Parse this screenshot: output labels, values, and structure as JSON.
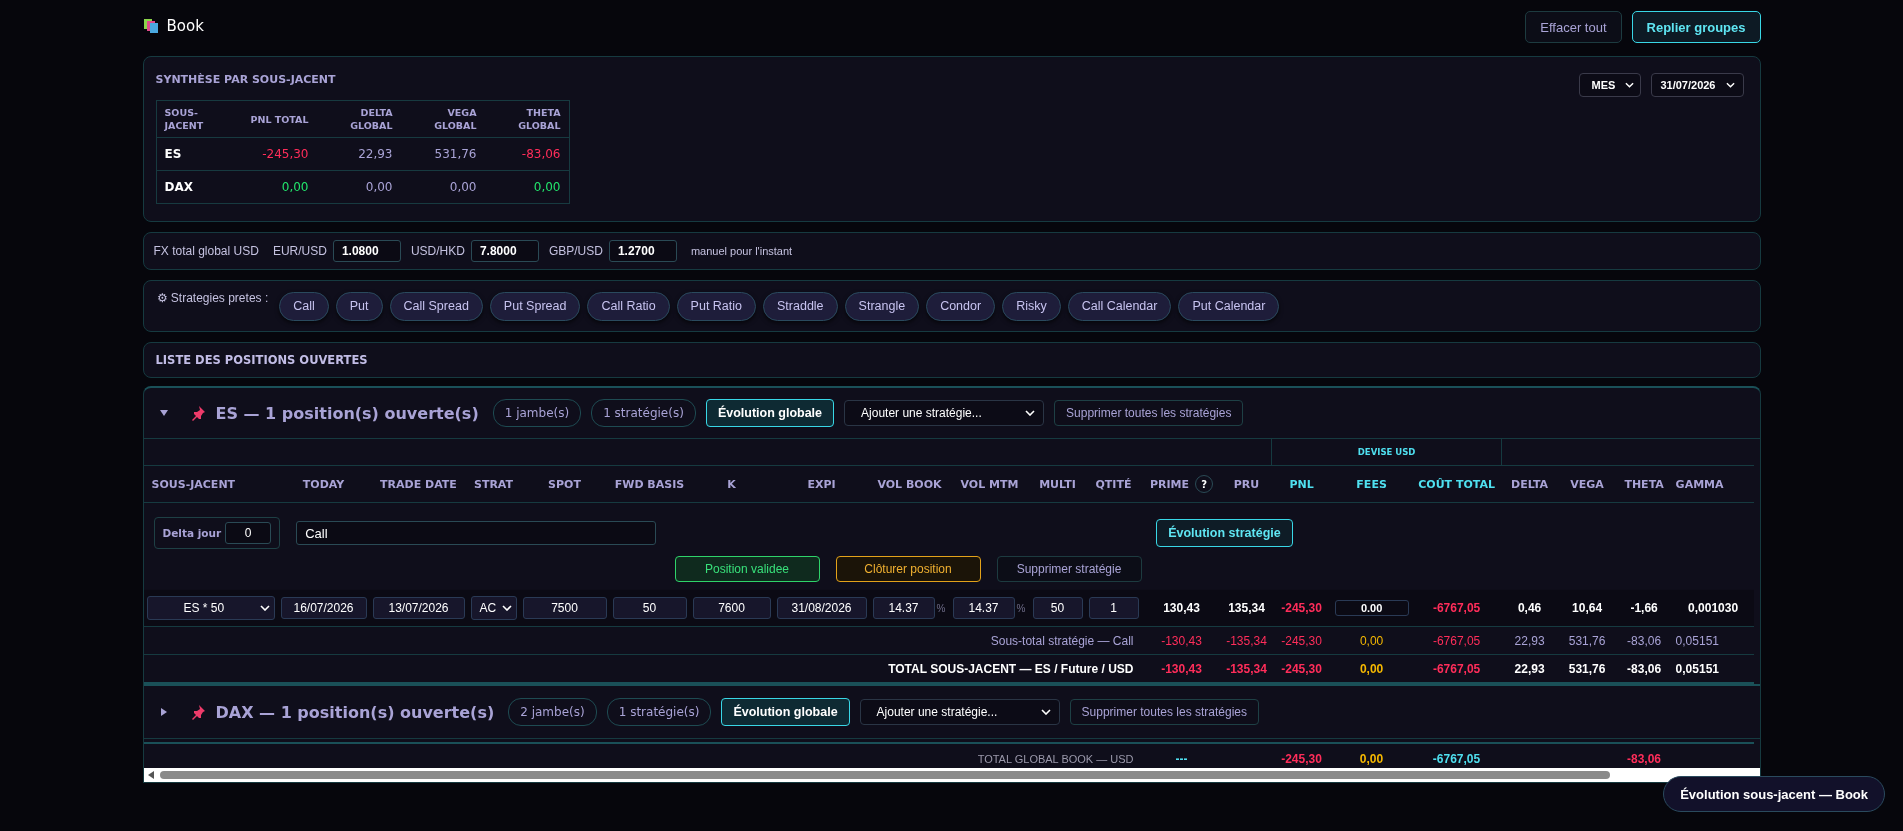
{
  "app": {
    "title": "Book"
  },
  "header_buttons": [
    {
      "label": "Effacer tout",
      "kind": "plain"
    },
    {
      "label": "Replier groupes",
      "kind": "accent"
    }
  ],
  "summary": {
    "title": "SYNTHÈSE PAR SOUS-JACENT",
    "period": "MES",
    "date": "31/07/2026",
    "columns": [
      "SOUS-JACENT",
      "PNL TOTAL",
      "DELTA GLOBAL",
      "VEGA GLOBAL",
      "THETA GLOBAL"
    ],
    "rows": [
      {
        "cells": [
          {
            "text": "ES",
            "color": "#ffffff"
          },
          {
            "text": "-245,30",
            "color": "#ff2d5a"
          },
          {
            "text": "22,93",
            "color": "#a9a3d6"
          },
          {
            "text": "531,76",
            "color": "#a9a3d6"
          },
          {
            "text": "-83,06",
            "color": "#ff2d5a"
          }
        ]
      },
      {
        "cells": [
          {
            "text": "DAX",
            "color": "#ffffff"
          },
          {
            "text": "0,00",
            "color": "#22e36b"
          },
          {
            "text": "0,00",
            "color": "#a9a3d6"
          },
          {
            "text": "0,00",
            "color": "#a9a3d6"
          },
          {
            "text": "0,00",
            "color": "#22e36b"
          }
        ]
      }
    ]
  },
  "fx": {
    "label": "FX total global USD",
    "pairs": [
      {
        "label": "EUR/USD",
        "value": "1.0800"
      },
      {
        "label": "USD/HKD",
        "value": "7.8000"
      },
      {
        "label": "GBP/USD",
        "value": "1.2700"
      }
    ],
    "note": "manuel pour l'instant"
  },
  "presets": {
    "label": "⚙ Strategies pretes :",
    "items": [
      "Call",
      "Put",
      "Call Spread",
      "Put Spread",
      "Call Ratio",
      "Put Ratio",
      "Straddle",
      "Strangle",
      "Condor",
      "Risky",
      "Call Calendar",
      "Put Calendar"
    ]
  },
  "positions_title": "LISTE DES POSITIONS OUVERTES",
  "groups": [
    {
      "title": "ES — 1 position(s) ouverte(s)",
      "expanded": true,
      "legs": "1 jambe(s)",
      "strategies": "1 stratégie(s)",
      "evolution": "Évolution globale",
      "add_select": "Ajouter une stratégie...",
      "delete_all": "Supprimer toutes les stratégies"
    },
    {
      "title": "DAX — 1 position(s) ouverte(s)",
      "expanded": false,
      "legs": "2 jambe(s)",
      "strategies": "1 stratégie(s)",
      "evolution": "Évolution globale",
      "add_select": "Ajouter une stratégie...",
      "delete_all": "Supprimer toutes les stratégies"
    }
  ],
  "table": {
    "currency_header": "DEVISE USD",
    "columns": [
      {
        "label": "SOUS-JACENT",
        "accent": false
      },
      {
        "label": "TODAY",
        "accent": false
      },
      {
        "label": "TRADE DATE",
        "accent": false
      },
      {
        "label": "STRAT",
        "accent": false
      },
      {
        "label": "SPOT",
        "accent": false
      },
      {
        "label": "FWD BASIS",
        "accent": false
      },
      {
        "label": "K",
        "accent": false
      },
      {
        "label": "EXPI",
        "accent": false
      },
      {
        "label": "VOL BOOK",
        "accent": false
      },
      {
        "label": "VOL MTM",
        "accent": false
      },
      {
        "label": "MULTI",
        "accent": false
      },
      {
        "label": "QTITÉ",
        "accent": false
      },
      {
        "label": "PRIME",
        "accent": false,
        "help": "?"
      },
      {
        "label": "PRU",
        "accent": false
      },
      {
        "label": "PNL",
        "accent": true
      },
      {
        "label": "FEES",
        "accent": true
      },
      {
        "label": "COÛT TOTAL",
        "accent": true
      },
      {
        "label": "DELTA",
        "accent": false
      },
      {
        "label": "VEGA",
        "accent": false
      },
      {
        "label": "THETA",
        "accent": false
      },
      {
        "label": "GAMMA",
        "accent": false
      }
    ],
    "strategy": {
      "delta_label": "Delta jour",
      "delta_value": "0",
      "name": "Call",
      "evolution": "Évolution stratégie",
      "actions": [
        {
          "label": "Position validee",
          "kind": "success"
        },
        {
          "label": "Clôturer position",
          "kind": "warning"
        },
        {
          "label": "Supprimer stratégie",
          "kind": "plain"
        }
      ]
    },
    "row": [
      {
        "kind": "select",
        "value": "ES * 50"
      },
      {
        "kind": "input",
        "value": "16/07/2026"
      },
      {
        "kind": "input",
        "value": "13/07/2026"
      },
      {
        "kind": "select",
        "value": "AC"
      },
      {
        "kind": "input",
        "value": "7500"
      },
      {
        "kind": "input",
        "value": "50"
      },
      {
        "kind": "input",
        "value": "7600"
      },
      {
        "kind": "input",
        "value": "31/08/2026"
      },
      {
        "kind": "pct",
        "value": "14.37",
        "unit": "%"
      },
      {
        "kind": "pct",
        "value": "14.37",
        "unit": "%"
      },
      {
        "kind": "input",
        "value": "50"
      },
      {
        "kind": "input",
        "value": "1"
      },
      {
        "kind": "text",
        "value": "130,43",
        "color": "#ffffff"
      },
      {
        "kind": "text",
        "value": "135,34",
        "color": "#ffffff"
      },
      {
        "kind": "text",
        "value": "-245,30",
        "color": "#ff2d5a"
      },
      {
        "kind": "fees",
        "value": "0.00"
      },
      {
        "kind": "text",
        "value": "-6767,05",
        "color": "#ff2d5a"
      },
      {
        "kind": "text",
        "value": "0,46",
        "color": "#ffffff"
      },
      {
        "kind": "text",
        "value": "10,64",
        "color": "#ffffff"
      },
      {
        "kind": "text",
        "value": "-1,66",
        "color": "#ffffff"
      },
      {
        "kind": "text",
        "value": "0,001030",
        "color": "#ffffff"
      }
    ],
    "subtotal": {
      "label": "Sous-total stratégie — Call",
      "bold": false,
      "cells": [
        {
          "text": "-130,43",
          "color": "#ff2d5a"
        },
        {
          "text": "-135,34",
          "color": "#ff2d5a"
        },
        {
          "text": "-245,30",
          "color": "#ff2d5a"
        },
        {
          "text": "0,00",
          "color": "#f5b800"
        },
        {
          "text": "-6767,05",
          "color": "#ff2d5a"
        },
        {
          "text": "22,93",
          "color": "#a9a3d6"
        },
        {
          "text": "531,76",
          "color": "#a9a3d6"
        },
        {
          "text": "-83,06",
          "color": "#a9a3d6"
        },
        {
          "text": "0,05151",
          "color": "#a9a3d6"
        }
      ]
    },
    "total": {
      "label": "TOTAL SOUS-JACENT — ES / Future / USD",
      "bold": true,
      "cells": [
        {
          "text": "-130,43",
          "color": "#ff2d5a"
        },
        {
          "text": "-135,34",
          "color": "#ff2d5a"
        },
        {
          "text": "-245,30",
          "color": "#ff2d5a"
        },
        {
          "text": "0,00",
          "color": "#f5b800"
        },
        {
          "text": "-6767,05",
          "color": "#ff2d5a"
        },
        {
          "text": "22,93",
          "color": "#ffffff"
        },
        {
          "text": "531,76",
          "color": "#ffffff"
        },
        {
          "text": "-83,06",
          "color": "#ffffff"
        },
        {
          "text": "0,05151",
          "color": "#ffffff"
        }
      ]
    },
    "global_total": {
      "label": "TOTAL GLOBAL BOOK — USD",
      "prime": {
        "text": "---",
        "color": "#4fe0f0"
      },
      "pnl": {
        "text": "-245,30",
        "color": "#ff2d5a"
      },
      "fees": {
        "text": "0,00",
        "color": "#f5b800"
      },
      "cost": {
        "text": "-6767,05",
        "color": "#4fe0f0"
      },
      "theta": {
        "text": "-83,06",
        "color": "#ff2d5a"
      }
    }
  },
  "float_button": "Évolution sous-jacent — Book"
}
